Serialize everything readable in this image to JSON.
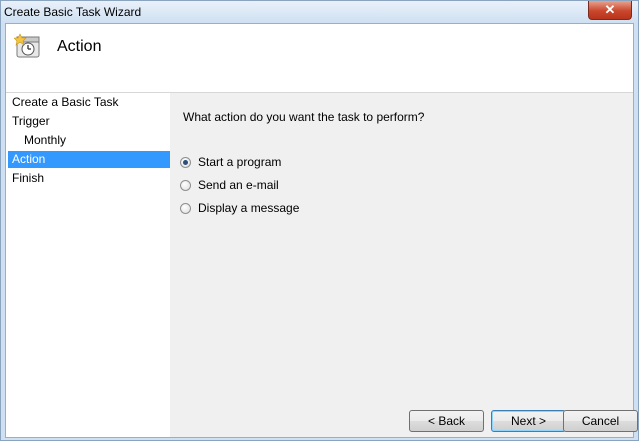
{
  "window": {
    "title": "Create Basic Task Wizard",
    "close_label": "✕"
  },
  "header": {
    "title": "Action",
    "icon": "task-clock-icon"
  },
  "nav": {
    "items": [
      {
        "label": "Create a Basic Task",
        "active": false,
        "sub": false
      },
      {
        "label": "Trigger",
        "active": false,
        "sub": false
      },
      {
        "label": "Monthly",
        "active": false,
        "sub": true
      },
      {
        "label": "Action",
        "active": true,
        "sub": false
      },
      {
        "label": "Finish",
        "active": false,
        "sub": false
      }
    ]
  },
  "main": {
    "question": "What action do you want the task to perform?",
    "options": [
      {
        "label": "Start a program",
        "checked": true
      },
      {
        "label": "Send an e-mail",
        "checked": false
      },
      {
        "label": "Display a message",
        "checked": false
      }
    ]
  },
  "buttons": {
    "back": "< Back",
    "next": "Next >",
    "cancel": "Cancel"
  },
  "colors": {
    "selection": "#3399ff"
  }
}
